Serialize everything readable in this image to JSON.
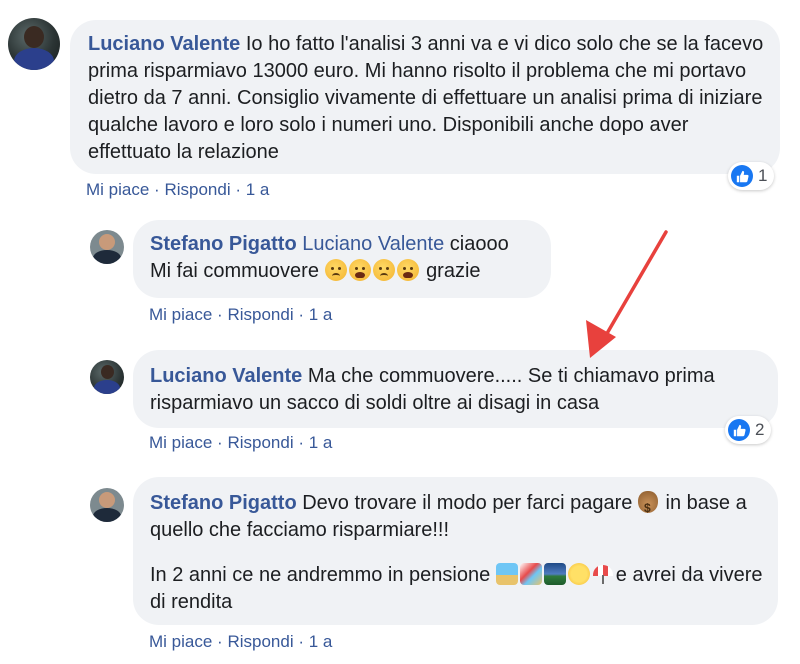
{
  "comments": [
    {
      "author": "Luciano Valente",
      "text": "Io ho fatto l'analisi 3 anni va e vi dico solo che se la facevo prima risparmiavo 13000 euro. Mi hanno risolto il problema che mi portavo dietro da 7 anni. Consiglio vivamente di effettuare un analisi prima di iniziare qualche lavoro e loro solo i numeri uno. Disponibili anche dopo aver effettuato la relazione",
      "like_label": "Mi piace",
      "reply_label": "Rispondi",
      "time": "1 a",
      "reaction_count": "1"
    },
    {
      "author": "Stefano Pigatto",
      "mention": "Luciano Valente",
      "text_line1": "ciaooo",
      "text_line2_before": "Mi fai commuovere",
      "text_line2_after": "grazie",
      "emojis": [
        "sad-face-icon",
        "crying-face-icon",
        "sad-face-icon",
        "crying-face-icon"
      ],
      "like_label": "Mi piace",
      "reply_label": "Rispondi",
      "time": "1 a"
    },
    {
      "author": "Luciano Valente",
      "text": "Ma che commuovere..... Se ti chiamavo prima risparmiavo un sacco di soldi oltre ai disagi in casa",
      "like_label": "Mi piace",
      "reply_label": "Rispondi",
      "time": "1 a",
      "reaction_count": "2"
    },
    {
      "author": "Stefano Pigatto",
      "text_p1_before": "Devo trovare il modo per farci pagare",
      "text_p1_after": "in base a quello che facciamo risparmiare!!!",
      "text_p2_before": "In 2 anni ce ne andremmo in pensione",
      "text_p2_after": "e avrei da vivere di rendita",
      "emojis": [
        "money-bag-icon",
        "beach-icon",
        "beach-umbrella-icon",
        "sunset-icon",
        "sun-icon",
        "umbrella-icon"
      ],
      "like_label": "Mi piace",
      "reply_label": "Rispondi",
      "time": "1 a"
    }
  ],
  "separator": "·",
  "colors": {
    "link_blue": "#385898",
    "bubble_gray": "#f0f2f5",
    "like_blue": "#1877f2",
    "arrow_red": "#e8413d"
  }
}
